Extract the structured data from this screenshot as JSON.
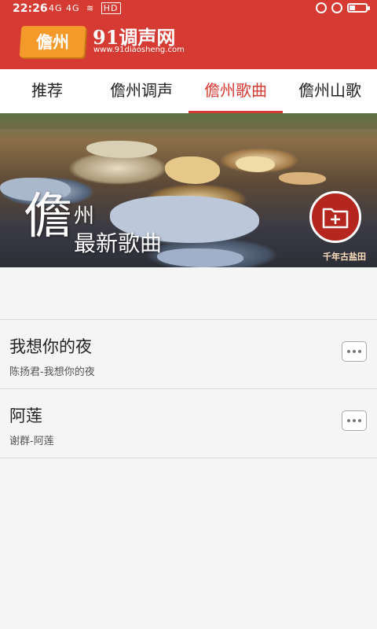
{
  "status_bar": {
    "time": "22:26",
    "left_icons": "4G 4G",
    "network_label": "HD",
    "battery_level": 0.35
  },
  "header": {
    "logo_badge": "儋州",
    "logo_title": "91调声网",
    "logo_url": "www.91diaosheng.com",
    "bg_color": "#d63b33",
    "logo_color": "#f39a2a"
  },
  "tabs": [
    {
      "label": "推荐",
      "active": false
    },
    {
      "label": "儋州调声",
      "active": false
    },
    {
      "label": "儋州歌曲",
      "active": true
    },
    {
      "label": "儋州山歌",
      "active": false
    }
  ],
  "banner": {
    "big_char": "儋",
    "line1": "州",
    "line2": "最新歌曲",
    "watermark": "千年古盐田",
    "add_icon": "folder-plus-icon"
  },
  "songs": [
    {
      "title": "我想你的夜",
      "subtitle": "陈扬君-我想你的夜"
    },
    {
      "title": "阿莲",
      "subtitle": "谢群-阿莲"
    }
  ],
  "colors": {
    "accent": "#d63b33",
    "background": "#f5f5f5"
  }
}
